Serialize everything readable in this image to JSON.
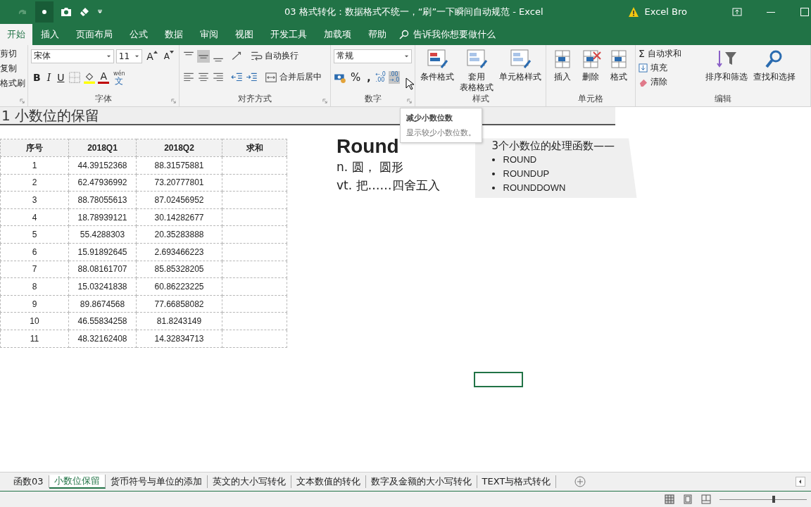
{
  "window": {
    "title": "03 格式转化：数据格式不统一，“刷”一下瞬间自动规范  -  Excel",
    "user": "Excel Bro"
  },
  "tabs": [
    {
      "label": "开始",
      "selected": true
    },
    {
      "label": "插入",
      "selected": false
    },
    {
      "label": "页面布局",
      "selected": false
    },
    {
      "label": "公式",
      "selected": false
    },
    {
      "label": "数据",
      "selected": false
    },
    {
      "label": "审阅",
      "selected": false
    },
    {
      "label": "视图",
      "selected": false
    },
    {
      "label": "开发工具",
      "selected": false
    },
    {
      "label": "加载项",
      "selected": false
    },
    {
      "label": "帮助",
      "selected": false
    }
  ],
  "tell_me": {
    "placeholder": "告诉我你想要做什么"
  },
  "ribbon": {
    "clipboard": {
      "items": [
        "剪切",
        "复制",
        "格式刷"
      ]
    },
    "font": {
      "name": "宋体",
      "size": "11",
      "grow": "A",
      "shrink": "A",
      "bold": "B",
      "italic": "I",
      "underline": "U",
      "color_button": "A",
      "phonetic_top": "wén",
      "phonetic": "文",
      "label": "字体"
    },
    "alignment": {
      "wrap": "自动换行",
      "merge": "合并后居中",
      "label": "对齐方式"
    },
    "number": {
      "format": "常规",
      "percent": "%",
      "comma": ",",
      "increase": [
        "←.0",
        ".00"
      ],
      "decrease": [
        ".00",
        "→.0"
      ],
      "label": "数字"
    },
    "styles": {
      "buttons": [
        {
          "lines": [
            "条件格式"
          ]
        },
        {
          "lines": [
            "套用",
            "表格格式"
          ]
        },
        {
          "lines": [
            "单元格样式"
          ]
        }
      ],
      "label": "样式"
    },
    "cells": {
      "buttons": [
        "插入",
        "删除",
        "格式"
      ],
      "label": "单元格"
    },
    "editing": {
      "sigma": "Σ",
      "items": [
        "自动求和",
        "填充",
        "清除"
      ],
      "buttons": [
        "排序和筛选",
        "查找和选择"
      ],
      "label": "编辑"
    }
  },
  "tooltip": {
    "title": "减少小数位数",
    "text": "显示较少小数位数。"
  },
  "sheet": {
    "heading": "1 小数位的保留",
    "table": {
      "columns": [
        "序号",
        "2018Q1",
        "2018Q2",
        "求和"
      ],
      "rows": [
        [
          "1",
          "44.39152368",
          "88.31575881",
          ""
        ],
        [
          "2",
          "62.47936992",
          "73.20777801",
          ""
        ],
        [
          "3",
          "88.78055613",
          "87.02456952",
          ""
        ],
        [
          "4",
          "18.78939121",
          "30.14282677",
          ""
        ],
        [
          "5",
          "55.4288303",
          "20.35283888",
          ""
        ],
        [
          "6",
          "15.91892645",
          "2.693466223",
          ""
        ],
        [
          "7",
          "88.08161707",
          "85.85328205",
          ""
        ],
        [
          "8",
          "15.03241838",
          "60.86223225",
          ""
        ],
        [
          "9",
          "89.8674568",
          "77.66858082",
          ""
        ],
        [
          "10",
          "46.55834258",
          "81.8243149",
          ""
        ],
        [
          "11",
          "48.32162408",
          "14.32834713",
          ""
        ]
      ]
    },
    "slide": {
      "word": "Round",
      "definitions": [
        "n. 圆， 圆形",
        "vt. 把……四舍五入"
      ],
      "intro": "3个小数位的处理函数——",
      "functions": [
        "ROUND",
        "ROUNDUP",
        "ROUNDDOWN"
      ]
    }
  },
  "status": {
    "zoom": {
      "level": 0.62
    }
  },
  "sheet_tabs": [
    {
      "label": "函数03",
      "selected": false
    },
    {
      "label": "小数位保留",
      "selected": true
    },
    {
      "label": "货币符号与单位的添加",
      "selected": false
    },
    {
      "label": "英文的大小写转化",
      "selected": false
    },
    {
      "label": "文本数值的转化",
      "selected": false
    },
    {
      "label": "数字及金额的大小写转化",
      "selected": false
    },
    {
      "label": "TEXT与格式转化",
      "selected": false
    }
  ]
}
